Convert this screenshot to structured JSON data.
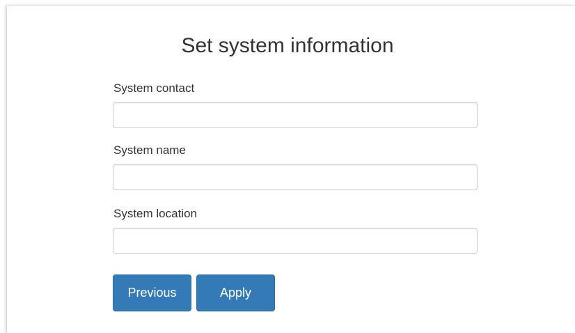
{
  "form": {
    "title": "Set system information",
    "fields": [
      {
        "label": "System contact",
        "value": "",
        "placeholder": ""
      },
      {
        "label": "System name",
        "value": "",
        "placeholder": ""
      },
      {
        "label": "System location",
        "value": "",
        "placeholder": ""
      }
    ],
    "buttons": {
      "previous_label": "Previous",
      "apply_label": "Apply"
    }
  },
  "colors": {
    "primary_button": "#337ab7",
    "text": "#333333",
    "input_border": "#cccccc"
  }
}
